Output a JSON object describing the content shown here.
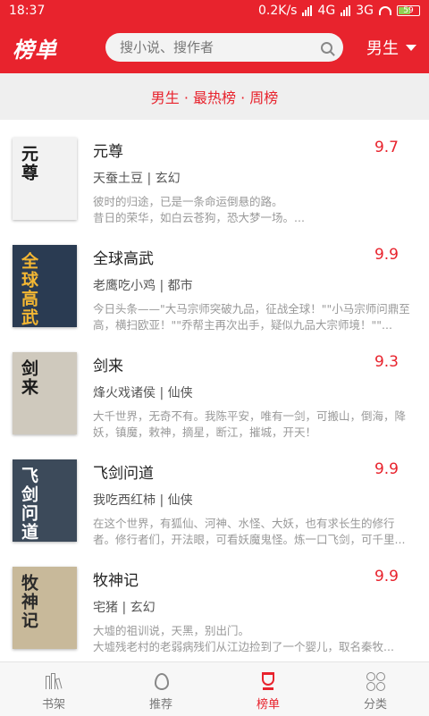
{
  "status_bar": {
    "time": "18:37",
    "network_speed": "0.2K/s",
    "network_1": "4G",
    "network_2": "3G",
    "battery": "59",
    "battery_level": 0.59
  },
  "header": {
    "title": "榜单",
    "search_placeholder": "搜小说、搜作者",
    "gender_label": "男生"
  },
  "subtitle": "男生 · 最热榜 · 周榜",
  "colors": {
    "accent": "#e8232d",
    "title": "#222222",
    "meta": "#555555",
    "desc": "#999999"
  },
  "books": [
    {
      "title": "元尊",
      "score": "9.7",
      "author_genre": "天蚕土豆 | 玄幻",
      "desc": "彼时的归途，已是一条命运倒悬的路。\n昔日的荣华，如白云苍狗，恐大梦一场。...",
      "cover_text": "元尊",
      "cover_bg": "#f2f2f2",
      "cover_fg": "#1a1a1a"
    },
    {
      "title": "全球高武",
      "score": "9.9",
      "author_genre": "老鹰吃小鸡 | 都市",
      "desc": "今日头条——\"大马宗师突破九品，征战全球！\"\"小马宗师问鼎至高，横扫欧亚！\"\"乔帮主再次出手，疑似九品大宗师境！\"\"...",
      "cover_text": "全球高武",
      "cover_bg": "#2a3b52",
      "cover_fg": "#f4b733"
    },
    {
      "title": "剑来",
      "score": "9.3",
      "author_genre": "烽火戏诸侯 | 仙侠",
      "desc": "大千世界，无奇不有。我陈平安，唯有一剑，可搬山，倒海，降妖，镇魔，敕神，摘星，断江，摧城，开天！",
      "cover_text": "剑来",
      "cover_bg": "#cfc9bd",
      "cover_fg": "#1a1a1a"
    },
    {
      "title": "飞剑问道",
      "score": "9.9",
      "author_genre": "我吃西红柿 | 仙侠",
      "desc": "在这个世界，有狐仙、河神、水怪、大妖，也有求长生的修行者。修行者们，开法眼，可看妖魔鬼怪。炼一口飞剑，可千里...",
      "cover_text": "飞剑问道",
      "cover_bg": "#3c4a5a",
      "cover_fg": "#ffffff"
    },
    {
      "title": "牧神记",
      "score": "9.9",
      "author_genre": "宅猪 | 玄幻",
      "desc": "大墟的祖训说，天黑，别出门。\n大墟残老村的老弱病残们从江边捡到了一个婴儿，取名秦牧...",
      "cover_text": "牧神记",
      "cover_bg": "#c8b99a",
      "cover_fg": "#2a2a2a"
    }
  ],
  "tabbar": [
    {
      "label": "书架",
      "icon": "bookshelf-icon",
      "active": false
    },
    {
      "label": "推荐",
      "icon": "flame-icon",
      "active": false
    },
    {
      "label": "榜单",
      "icon": "trophy-icon",
      "active": true
    },
    {
      "label": "分类",
      "icon": "category-icon",
      "active": false
    }
  ]
}
